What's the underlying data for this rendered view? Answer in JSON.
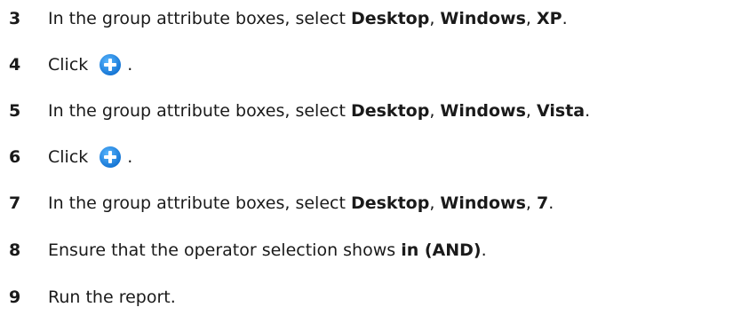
{
  "steps": [
    {
      "number": "3",
      "prefix": "In the group attribute boxes, select ",
      "opt1": "Desktop",
      "sep1": ", ",
      "opt2": "Windows",
      "sep2": ", ",
      "opt3": "XP",
      "suffix": "."
    },
    {
      "number": "4",
      "prefix": "Click",
      "icon": "add-circle-icon",
      "suffix": "."
    },
    {
      "number": "5",
      "prefix": "In the group attribute boxes, select ",
      "opt1": "Desktop",
      "sep1": ", ",
      "opt2": "Windows",
      "sep2": ", ",
      "opt3": "Vista",
      "suffix": "."
    },
    {
      "number": "6",
      "prefix": "Click",
      "icon": "add-circle-icon",
      "suffix": "."
    },
    {
      "number": "7",
      "prefix": "In the group attribute boxes, select ",
      "opt1": "Desktop",
      "sep1": ", ",
      "opt2": "Windows",
      "sep2": ", ",
      "opt3": "7",
      "suffix": "."
    },
    {
      "number": "8",
      "prefix": "Ensure that the operator selection shows ",
      "bold": "in (AND)",
      "suffix": "."
    },
    {
      "number": "9",
      "text": "Run the report."
    }
  ],
  "colors": {
    "text": "#1a1a1a",
    "icon_blue": "#1a86e0"
  }
}
